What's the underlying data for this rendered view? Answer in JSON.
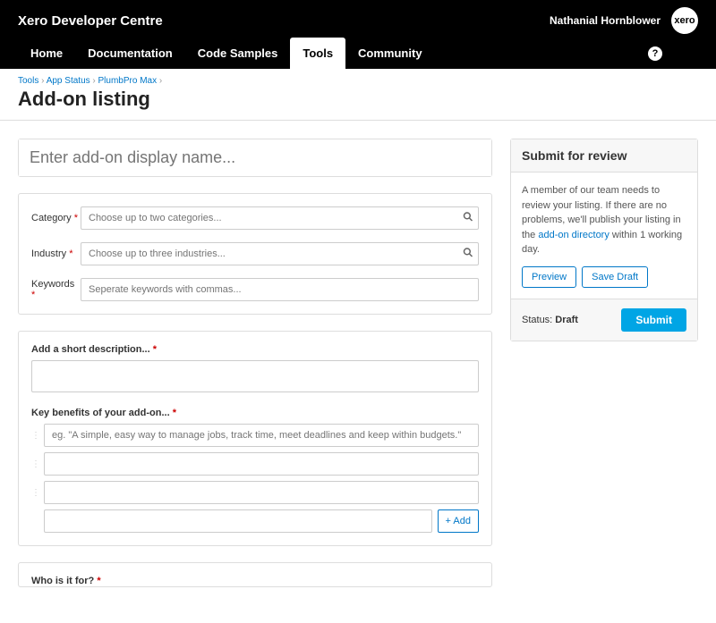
{
  "header": {
    "site_title": "Xero Developer Centre",
    "username": "Nathanial Hornblower",
    "logo_text": "xero",
    "nav": [
      "Home",
      "Documentation",
      "Code Samples",
      "Tools",
      "Community"
    ],
    "help_glyph": "?"
  },
  "breadcrumb": {
    "items": [
      "Tools",
      "App Status",
      "PlumbPro Max"
    ],
    "sep": " › "
  },
  "page_title": "Add-on listing",
  "form": {
    "name_placeholder": "Enter add-on display name...",
    "category_label": "Category",
    "category_placeholder": "Choose up to two categories...",
    "industry_label": "Industry",
    "industry_placeholder": "Choose up to three industries...",
    "keywords_label": "Keywords",
    "keywords_placeholder": "Seperate keywords with commas...",
    "short_desc_label": "Add a short description...",
    "benefits_label": "Key benefits of your add-on...",
    "benefit_placeholder": "eg. \"A simple, easy way to manage jobs, track time, meet deadlines and keep within budgets.\"",
    "add_button": "+ Add",
    "who_label": "Who is it for?",
    "req_glyph": "*"
  },
  "sidebar": {
    "heading": "Submit for review",
    "body_text_1": "A member of our team needs to review your listing. If there are no problems, we'll publish your listing in the ",
    "body_link": "add-on directory",
    "body_text_2": " within 1 working day.",
    "preview_btn": "Preview",
    "save_draft_btn": "Save Draft",
    "status_label": "Status: ",
    "status_value": "Draft",
    "submit_btn": "Submit"
  }
}
